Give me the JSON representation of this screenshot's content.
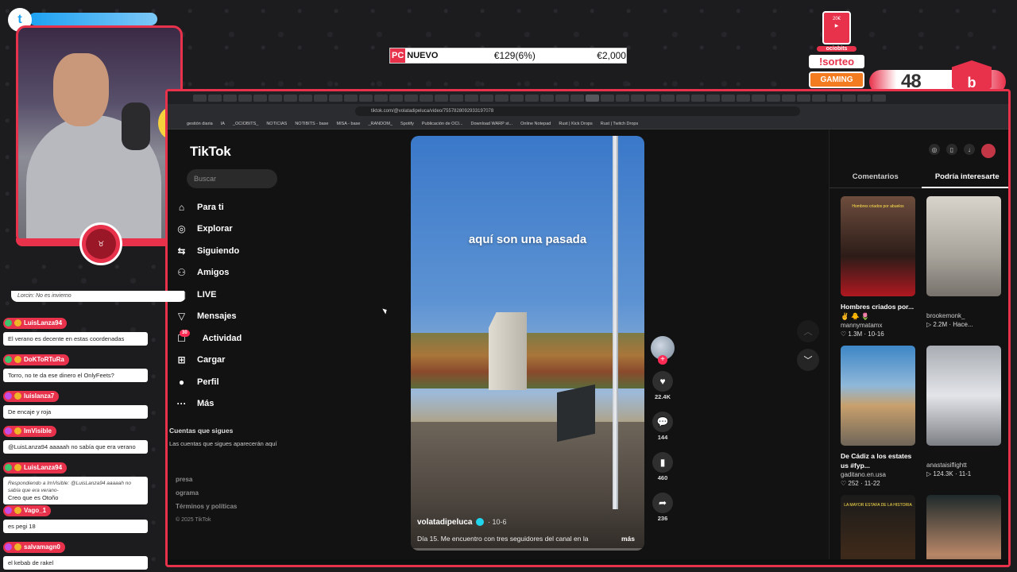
{
  "overlay": {
    "twitter_handle": "",
    "price": {
      "tag": "PC",
      "name": "NUEVO",
      "old_price": "€129(6%)",
      "new_price": "€2,000"
    },
    "giveaway": {
      "sorteo": "!sorteo",
      "gaming": "GAMING",
      "brand": "ociobits"
    },
    "counter": "48",
    "colors": {
      "accent": "#e8314b",
      "tiktok_red": "#fe2c55"
    }
  },
  "browser": {
    "url": "tiktok.com/@volatadipeluca/video/7557828092933197078",
    "bookmarks": [
      "gestión diaria",
      "IA",
      "_OCIOBITS_",
      "NOTICIAS",
      "NOTIBITS - base",
      "MISA - base",
      "_RANDOM_",
      "Spotify",
      "Publicación de OCI...",
      "Download WARP st...",
      "Online Notepad",
      "Rust | Kick Drops",
      "Rust | Twitch Drops"
    ]
  },
  "tiktok": {
    "logo": "TikTok",
    "search_placeholder": "Buscar",
    "nav": [
      {
        "icon": "home-icon",
        "glyph": "⌂",
        "label": "Para ti"
      },
      {
        "icon": "compass-icon",
        "glyph": "◎",
        "label": "Explorar"
      },
      {
        "icon": "following-icon",
        "glyph": "⇆",
        "label": "Siguiendo"
      },
      {
        "icon": "friends-icon",
        "glyph": "⚇",
        "label": "Amigos"
      },
      {
        "icon": "live-icon",
        "glyph": "▣",
        "label": "LIVE"
      },
      {
        "icon": "messages-icon",
        "glyph": "▽",
        "label": "Mensajes"
      },
      {
        "icon": "activity-icon",
        "glyph": "☐",
        "label": "Actividad",
        "badge": "30"
      },
      {
        "icon": "upload-icon",
        "glyph": "⊞",
        "label": "Cargar"
      },
      {
        "icon": "profile-icon",
        "glyph": "●",
        "label": "Perfil"
      },
      {
        "icon": "more-icon",
        "glyph": "···",
        "label": "Más"
      }
    ],
    "following": {
      "title": "Cuentas que sigues",
      "text": "Las cuentas que sigues aparecerán aquí"
    },
    "footer": [
      "presa",
      "ograma",
      "Términos y políticas"
    ],
    "copyright": "© 2025 TikTok",
    "video": {
      "overlay_text": "aquí son una pasada",
      "author": "volatadipeluca",
      "date": "10-6",
      "description": "Día 15. Me encuentro con tres seguidores del canal en la",
      "more": "más",
      "progress": 0.0
    },
    "actions": {
      "likes": "22.4K",
      "comments": "144",
      "saves": "460",
      "shares": "236"
    },
    "right_panel": {
      "tabs": [
        "Comentarios",
        "Podría interesarte"
      ],
      "active_tab": 1,
      "cards": [
        {
          "title": "Hombres criados por... ✌️ 🐥 🌷",
          "author": "mannymatamx",
          "stats": "♡ 1.3M · 10-16",
          "overlay": "Hombres criados por abuelos"
        },
        {
          "title": "",
          "author": "brookemonk_",
          "stats": "▷ 2.2M · Hace...",
          "overlay": ""
        },
        {
          "title": "De Cádiz a los estates us #fyp...",
          "author": "gaditano.en.usa",
          "stats": "♡ 252 · 11-22",
          "overlay": ""
        },
        {
          "title": "",
          "author": "anastaisiflightt",
          "stats": "▷ 124.3K · 11-1",
          "overlay": ""
        },
        {
          "title": "",
          "author": "",
          "stats": "",
          "overlay": "LA MAYOR ESTAFA DE LA HISTORIA"
        },
        {
          "title": "",
          "author": "",
          "stats": "",
          "overlay": ""
        }
      ]
    }
  },
  "chat": {
    "cut_message": "Lorcin: No es invierno",
    "messages": [
      {
        "user": "LuisLanza94",
        "text": "El verano es decente en estas coordenadas",
        "reply": ""
      },
      {
        "user": "DoKToRTuRa",
        "text": "Torro, no te da ese dinero el OnlyFeets?",
        "reply": ""
      },
      {
        "user": "luislanza7",
        "text": "De encaje y roja",
        "reply": ""
      },
      {
        "user": "ImVisible",
        "text": "@LuisLanza94 aaaaah no sabía que era verano",
        "reply": ""
      },
      {
        "user": "LuisLanza94",
        "text": "Creo que es Otoño",
        "reply": "Respondiendo a ImVisible: @LuisLanza94 aaaaah no sabía que era verano-"
      },
      {
        "user": "Vago_1",
        "text": "es pegi 18",
        "reply": ""
      },
      {
        "user": "salvamagn0",
        "text": "el kebab de rakel",
        "reply": ""
      }
    ]
  }
}
